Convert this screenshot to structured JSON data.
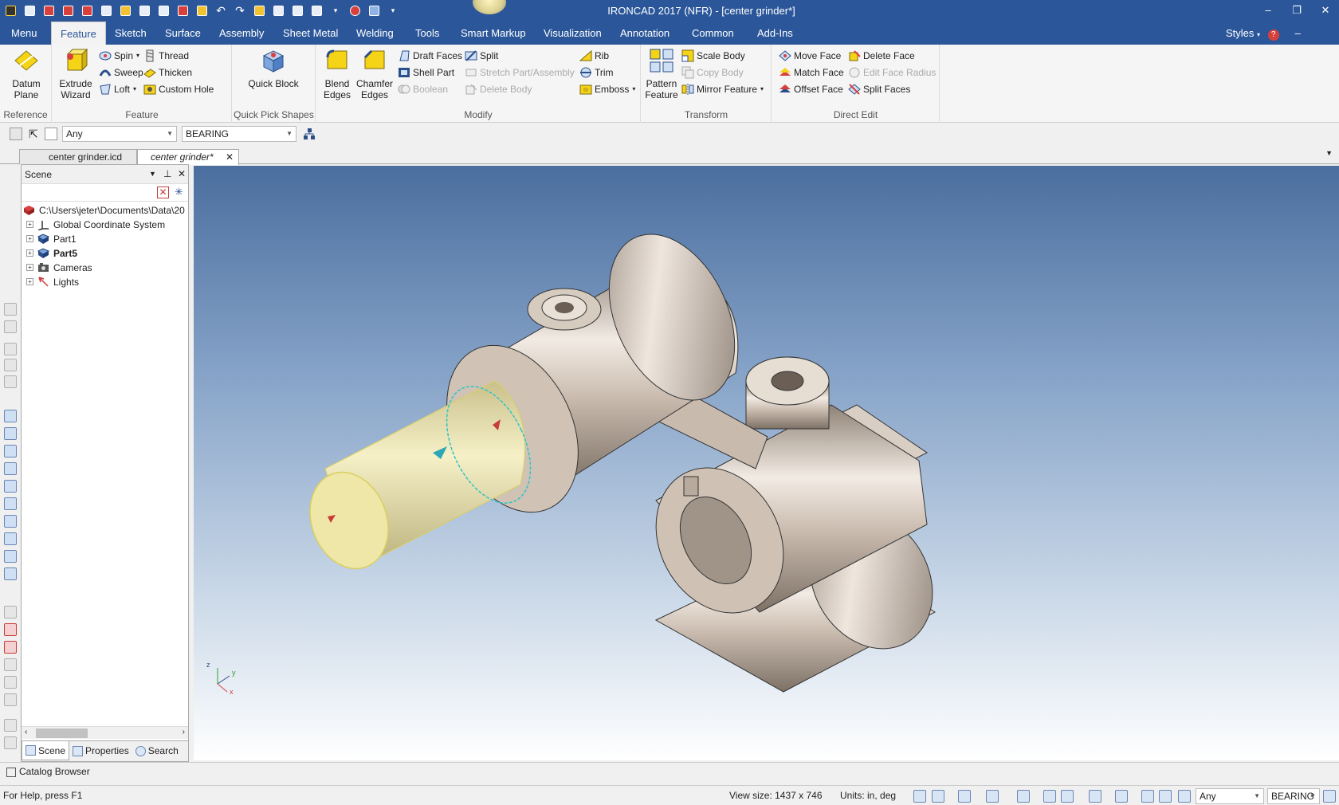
{
  "title_bar": {
    "app_title": "IRONCAD 2017 (NFR) - [center grinder*]",
    "quick_access_icons": [
      "app-menu-icon",
      "new-icon",
      "new-part-icon",
      "new-assembly-icon",
      "new-drawing-icon",
      "catalog-icon",
      "open-icon",
      "save-icon",
      "print-icon",
      "export-icon",
      "undo-icon",
      "redo-icon",
      "render-icon",
      "smart-snap-icon",
      "scene-browser-icon",
      "layout-icon",
      "view-options-icon",
      "help-icon",
      "tutorial-icon",
      "customize-icon"
    ],
    "window_controls": {
      "minimize": "–",
      "restore": "❐",
      "close": "✕"
    }
  },
  "menu_tabs": [
    "Menu",
    "Feature",
    "Sketch",
    "Surface",
    "Assembly",
    "Sheet Metal",
    "Welding",
    "Tools",
    "Smart Markup",
    "Visualization",
    "Annotation",
    "Common",
    "Add-Ins"
  ],
  "active_tab": "Feature",
  "right_menu": {
    "styles": "Styles",
    "help": "?"
  },
  "ribbon": {
    "reference": {
      "label": "Reference",
      "datum_plane": "Datum Plane"
    },
    "feature": {
      "label": "Feature",
      "extrude_wizard": "Extrude Wizard",
      "spin": "Spin",
      "sweep": "Sweep",
      "loft": "Loft",
      "thread": "Thread",
      "thicken": "Thicken",
      "custom_hole": "Custom Hole"
    },
    "quick_pick": {
      "label": "Quick Pick Shapes",
      "quick_block": "Quick Block"
    },
    "modify": {
      "label": "Modify",
      "blend_edges": "Blend Edges",
      "chamfer_edges": "Chamfer Edges",
      "draft_faces": "Draft Faces",
      "shell_part": "Shell Part",
      "boolean": "Boolean",
      "split": "Split",
      "stretch": "Stretch Part/Assembly",
      "delete_body": "Delete Body",
      "rib": "Rib",
      "trim": "Trim",
      "emboss": "Emboss"
    },
    "transform": {
      "label": "Transform",
      "pattern_feature": "Pattern Feature",
      "scale_body": "Scale Body",
      "copy_body": "Copy Body",
      "mirror_feature": "Mirror Feature"
    },
    "direct_edit": {
      "label": "Direct Edit",
      "move_face": "Move Face",
      "match_face": "Match Face",
      "offset_face": "Offset Face",
      "delete_face": "Delete Face",
      "edit_face_radius": "Edit Face Radius",
      "split_faces": "Split Faces"
    }
  },
  "selection_bar": {
    "filter": "Any",
    "part": "BEARING"
  },
  "doc_tabs": [
    "center grinder.icd",
    "center grinder*"
  ],
  "scene_panel": {
    "title": "Scene",
    "tree": [
      {
        "label": "C:\\Users\\jeter\\Documents\\Data\\20",
        "icon": "scene-root-icon",
        "bold": false
      },
      {
        "label": "Global Coordinate System",
        "icon": "coordinate-system-icon",
        "bold": false
      },
      {
        "label": "Part1",
        "icon": "part-icon",
        "bold": false
      },
      {
        "label": "Part5",
        "icon": "part-icon",
        "bold": true
      },
      {
        "label": "Cameras",
        "icon": "camera-icon",
        "bold": false
      },
      {
        "label": "Lights",
        "icon": "light-icon",
        "bold": false
      }
    ],
    "tabs": [
      "Scene",
      "Properties",
      "Search"
    ]
  },
  "viewport": {
    "triad": {
      "z": "z",
      "y": "y",
      "x": "x"
    }
  },
  "catalog_browser": "Catalog Browser",
  "status_bar": {
    "help": "For Help, press F1",
    "view_size": "View size: 1437 x  746",
    "units": "Units: in, deg",
    "filter": "Any",
    "part": "BEARING"
  },
  "colors": {
    "accent": "#2b579a",
    "selected_face": "#efe7a8",
    "part_metal": "#cbbdb0"
  }
}
